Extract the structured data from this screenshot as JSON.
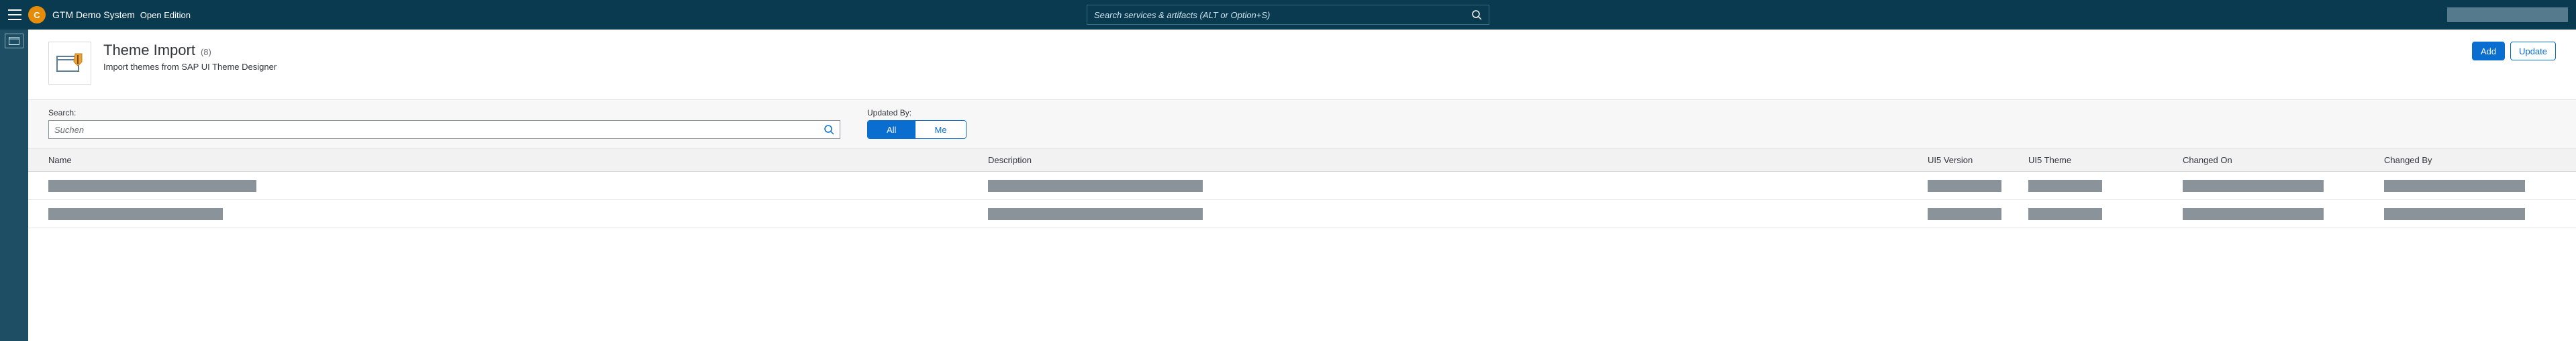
{
  "shell": {
    "avatar_initial": "C",
    "title": "GTM Demo System",
    "edition": "Open Edition",
    "search_placeholder": "Search services & artifacts (ALT or Option+S)"
  },
  "page": {
    "title": "Theme Import",
    "count": "(8)",
    "subtitle": "Import themes from SAP UI Theme Designer",
    "actions": {
      "add": "Add",
      "update": "Update"
    }
  },
  "filters": {
    "search_label": "Search:",
    "search_placeholder": "Suchen",
    "updated_by_label": "Updated By:",
    "seg_all": "All",
    "seg_me": "Me"
  },
  "table": {
    "columns": {
      "name": "Name",
      "description": "Description",
      "ui5_version": "UI5 Version",
      "ui5_theme": "UI5 Theme",
      "changed_on": "Changed On",
      "changed_by": "Changed By"
    }
  }
}
